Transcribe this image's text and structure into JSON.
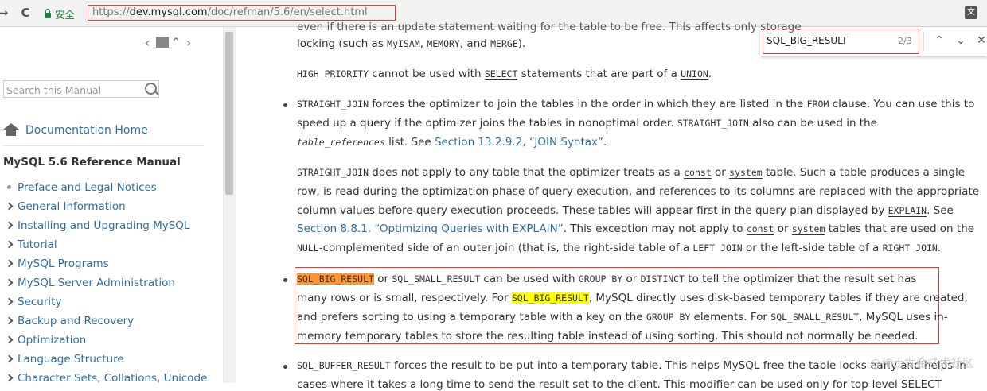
{
  "browser": {
    "back": "→",
    "reload": "C",
    "secure_label": "安全",
    "url_prefix": "https://",
    "url_host": "dev.mysql.com",
    "url_path": "/doc/refman/5.6/en/select.html",
    "translate_glyph": "文"
  },
  "find": {
    "query": "SQL_BIG_RESULT",
    "count": "2/3",
    "up": "⌃",
    "down": "⌄",
    "close": "✕"
  },
  "sidebar": {
    "search_placeholder": "Search this Manual",
    "home_label": "Documentation Home",
    "manual_title": "MySQL 5.6 Reference Manual",
    "toc": [
      {
        "label": "Preface and Legal Notices",
        "marker": "bullet"
      },
      {
        "label": "General Information",
        "marker": "chevron"
      },
      {
        "label": "Installing and Upgrading MySQL",
        "marker": "chevron"
      },
      {
        "label": "Tutorial",
        "marker": "chevron"
      },
      {
        "label": "MySQL Programs",
        "marker": "chevron"
      },
      {
        "label": "MySQL Server Administration",
        "marker": "chevron"
      },
      {
        "label": "Security",
        "marker": "chevron"
      },
      {
        "label": "Backup and Recovery",
        "marker": "chevron"
      },
      {
        "label": "Optimization",
        "marker": "chevron"
      },
      {
        "label": "Language Structure",
        "marker": "chevron"
      },
      {
        "label": "Character Sets, Collations, Unicode",
        "marker": "chevron"
      }
    ]
  },
  "content": {
    "p0_top": "even if there is an update statement waiting for the table to be free. This affects only storage",
    "p0_b1": "locking (such as ",
    "p0_c1": "MyISAM",
    "p0_b2": ", ",
    "p0_c2": "MEMORY",
    "p0_b3": ", and ",
    "p0_c3": "MERGE",
    "p0_b4": ").",
    "p1_c1": "HIGH_PRIORITY",
    "p1_t1": " cannot be used with ",
    "p1_c2": "SELECT",
    "p1_t2": " statements that are part of a ",
    "p1_c3": "UNION",
    "p1_t3": ".",
    "p2_c1": "STRAIGHT_JOIN",
    "p2_t1": " forces the optimizer to join the tables in the order in which they are listed in the ",
    "p2_c2": "FROM",
    "p2_t2": " clause. You can use this to",
    "p2_l2_t1": "speed up a query if the optimizer joins the tables in nonoptimal order. ",
    "p2_l2_c1": "STRAIGHT_JOIN",
    "p2_l2_t2": " also can be used in the",
    "p2_l3_i1": "table_references",
    "p2_l3_t1": " list. See ",
    "p2_l3_link": "Section 13.2.9.2, “JOIN Syntax”",
    "p2_l3_t2": ".",
    "p3_c1": "STRAIGHT_JOIN",
    "p3_t1": " does not apply to any table that the optimizer treats as a ",
    "p3_c2": "const",
    "p3_t2": " or ",
    "p3_c3": "system",
    "p3_t3": " table. Such a table produces a single",
    "p3_l2": "row, is read during the optimization phase of query execution, and references to its columns are replaced with the appropriate",
    "p3_l3_t1": "column values before query execution proceeds. These tables will appear first in the query plan displayed by ",
    "p3_l3_c1": "EXPLAIN",
    "p3_l3_t2": ". See",
    "p3_l4_link": "Section 8.8.1, “Optimizing Queries with EXPLAIN”",
    "p3_l4_t1": ". This exception may not apply to ",
    "p3_l4_c1": "const",
    "p3_l4_t2": " or ",
    "p3_l4_c2": "system",
    "p3_l4_t3": " tables that are used on the",
    "p3_l5_c1": "NULL",
    "p3_l5_t1": "-complemented side of an outer join (that is, the right-side table of a ",
    "p3_l5_c2": "LEFT JOIN",
    "p3_l5_t2": " or the left-side table of a ",
    "p3_l5_c3": "RIGHT JOIN",
    "p3_l5_t3": ".",
    "p4_c1": "SQL_BIG_RESULT",
    "p4_t1": " or ",
    "p4_c2": "SQL_SMALL_RESULT",
    "p4_t2": " can be used with ",
    "p4_c3": "GROUP BY",
    "p4_t3": " or ",
    "p4_c4": "DISTINCT",
    "p4_t4": " to tell the optimizer that the result set has",
    "p4_l2_t1": "many rows or is small, respectively. For ",
    "p4_l2_c1": "SQL_BIG_RESULT",
    "p4_l2_t2": ", MySQL directly uses disk-based temporary tables if they are created,",
    "p4_l3_t1": "and prefers sorting to using a temporary table with a key on the ",
    "p4_l3_c1": "GROUP BY",
    "p4_l3_t2": " elements. For ",
    "p4_l3_c2": "SQL_SMALL_RESULT",
    "p4_l3_t3": ", MySQL uses in-",
    "p4_l4": "memory temporary tables to store the resulting table instead of using sorting. This should not normally be needed.",
    "p5_c1": "SQL_BUFFER_RESULT",
    "p5_t1": " forces the result to be put into a temporary table. This helps MySQL free the table locks early and helps in",
    "p5_l2": "cases where it takes a long time to send the result set to the client. This modifier can be used only for top-level SELECT"
  },
  "watermark": "@稀土掘金技术社区"
}
